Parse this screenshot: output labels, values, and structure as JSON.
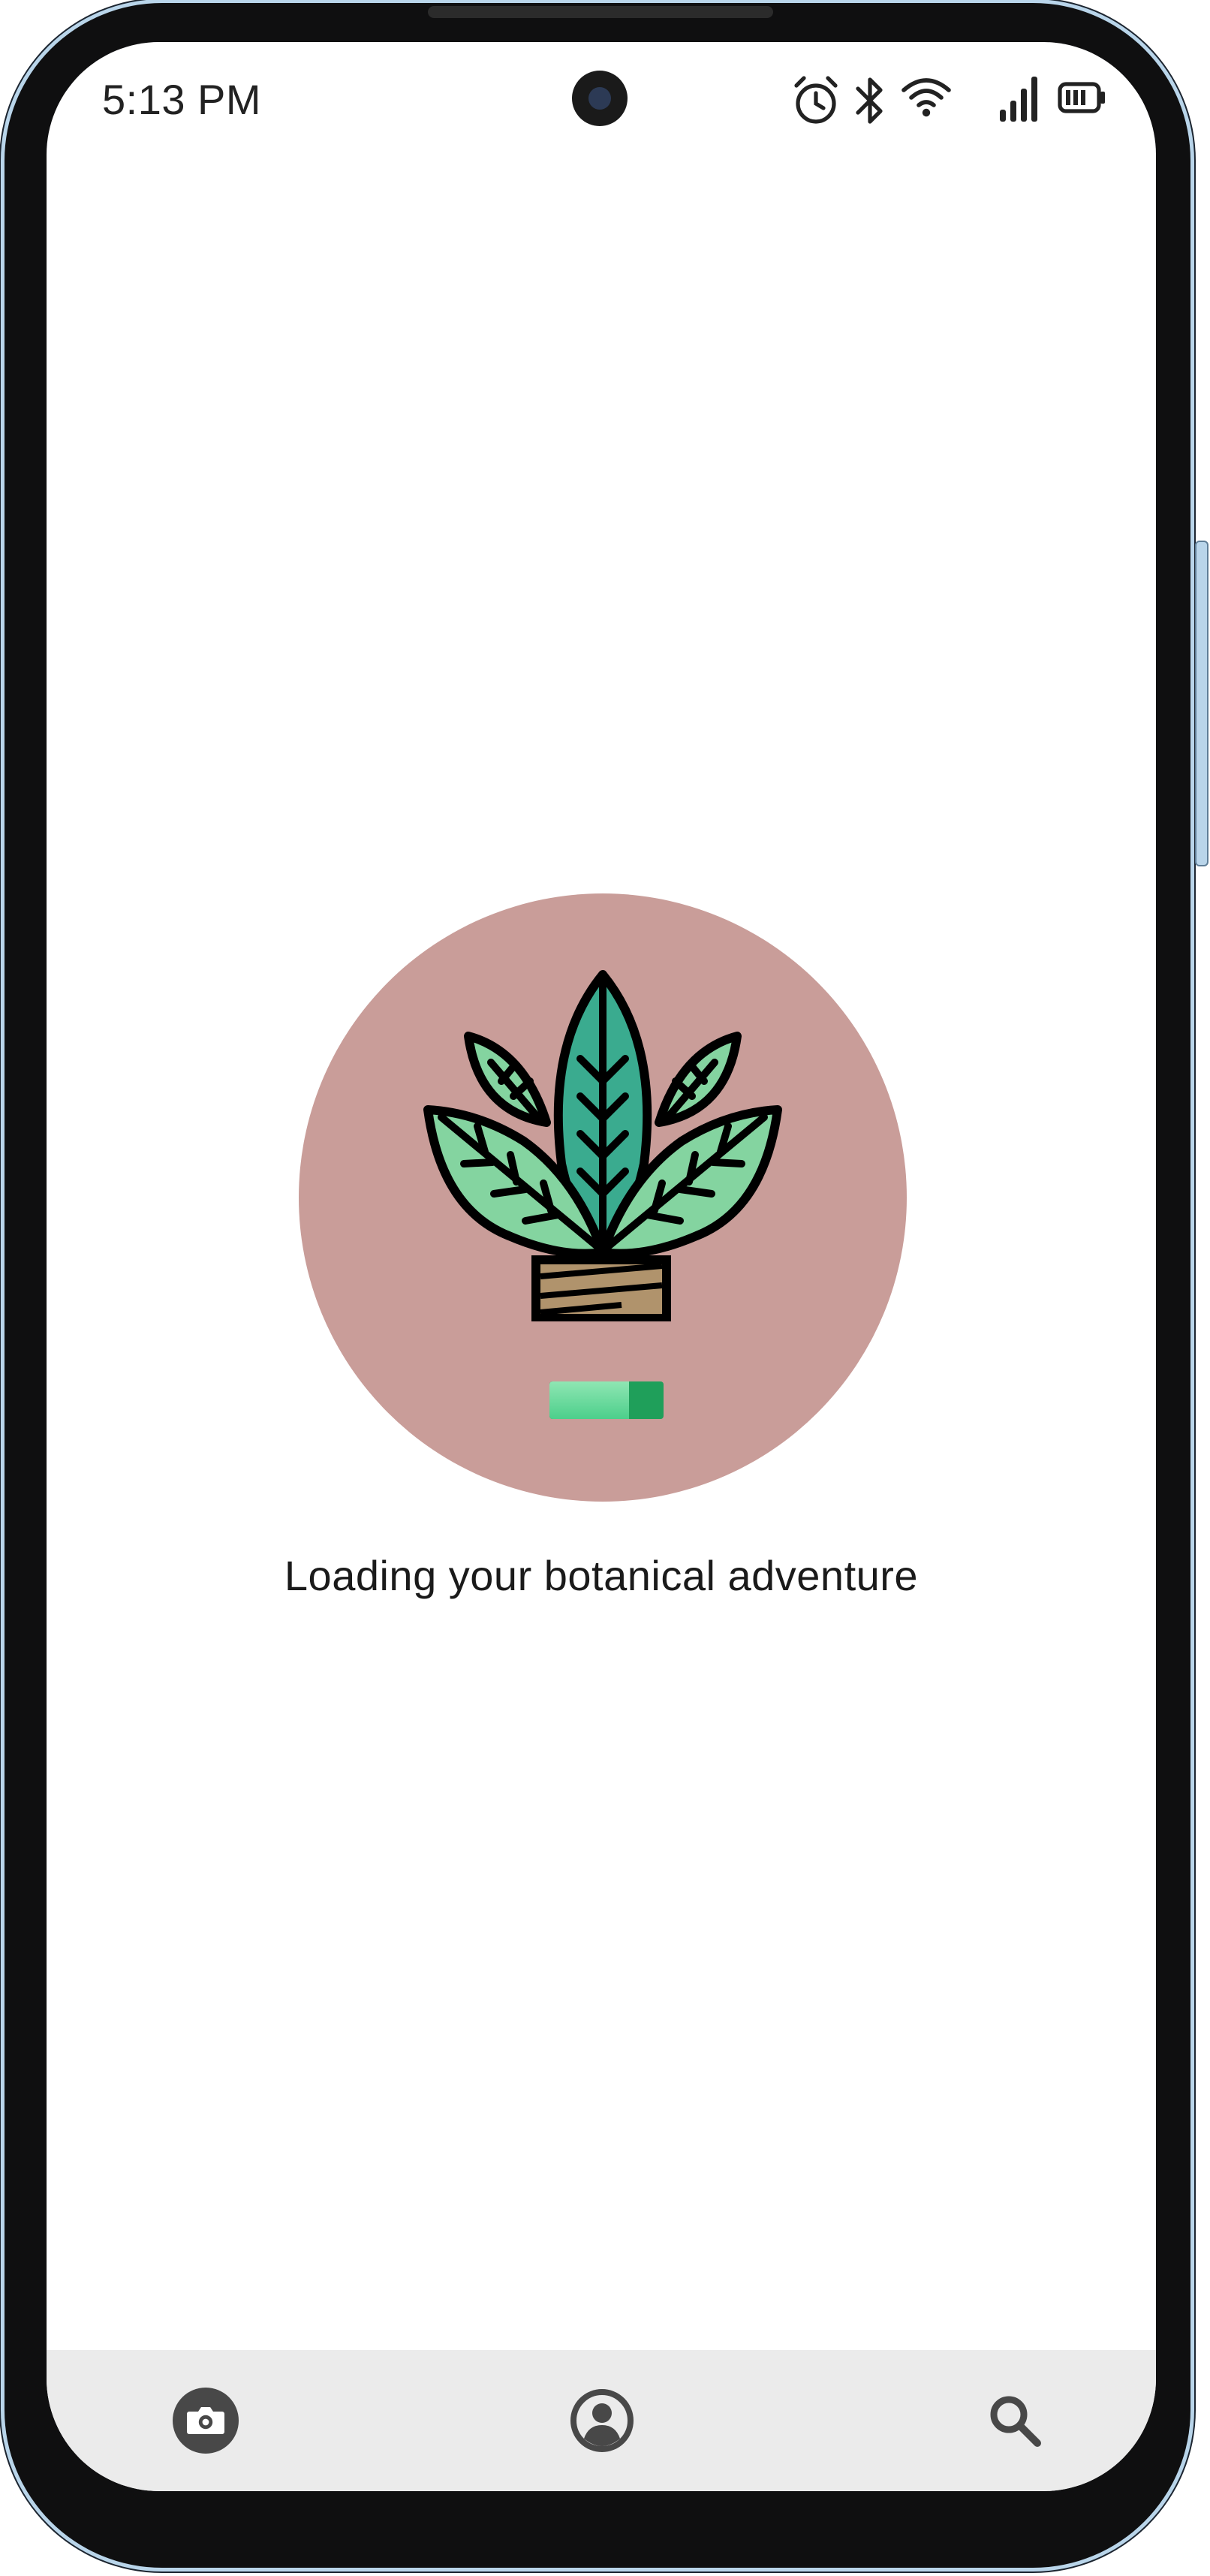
{
  "status_bar": {
    "time": "5:13 PM",
    "icons": [
      "alarm-icon",
      "bluetooth-icon",
      "wifi-icon",
      "signal-icon",
      "battery-icon"
    ]
  },
  "splash": {
    "logo": "potted-plant-icon",
    "loading_text": "Loading your botanical adventure",
    "loading_progress": 0.7,
    "colors": {
      "circle": "#c99d99",
      "leaf_dark": "#3aab8f",
      "leaf_light": "#84d4a0",
      "pot": "#b0936c",
      "bar_fill": "#5bd896",
      "bar_track": "#1f9f5a"
    }
  },
  "bottom_nav": {
    "items": [
      {
        "name": "camera",
        "icon": "camera-icon"
      },
      {
        "name": "profile",
        "icon": "account-circle-icon"
      },
      {
        "name": "search",
        "icon": "search-icon"
      }
    ],
    "background": "#ebebeb"
  }
}
